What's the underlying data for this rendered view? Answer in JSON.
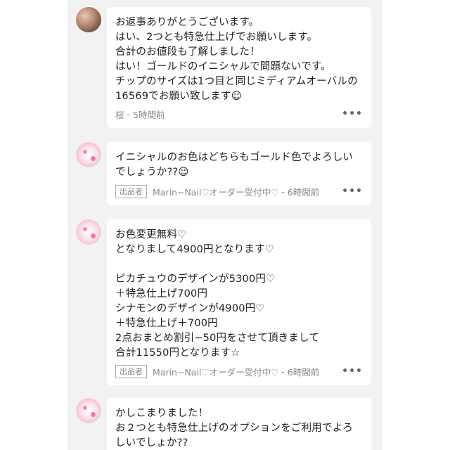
{
  "comments": [
    {
      "message": "お返事ありがとうございます。\nはい、2つとも特急仕上げでお願いします。\n合計のお値段も了解しました！\nはい！ゴールドのイニシャルで問題ないです。\nチップのサイズは1つ目と同じミディアムオーバルの16569でお願い致します☺",
      "author": "桜",
      "time": "5時間前",
      "badge": ""
    },
    {
      "message": "イニシャルのお色はどちらもゴールド色でよろしいでしょうか??☺",
      "author": "Marin−Nail♡オーダー受付中♡",
      "time": "6時間前",
      "badge": "出品者"
    },
    {
      "message": "お色変更無料♡\nとなりまして4900円となります♡\n\nピカチュウのデザインが5300円♡\n＋特急仕上げ700円\nシナモンのデザインが4900円♡\n＋特急仕上げ＋700円\n2点おまとめ割引−50円をさせて頂きまして\n合計11550円となります☆",
      "author": "Marin−Nail♡オーダー受付中♡",
      "time": "6時間前",
      "badge": "出品者"
    },
    {
      "message": "かしこまりました！\nお２つとも特急仕上げのオプションをご利用でよろしいでしょか??",
      "author": "",
      "time": "",
      "badge": ""
    }
  ],
  "separator": " - ",
  "more_label": "•••"
}
